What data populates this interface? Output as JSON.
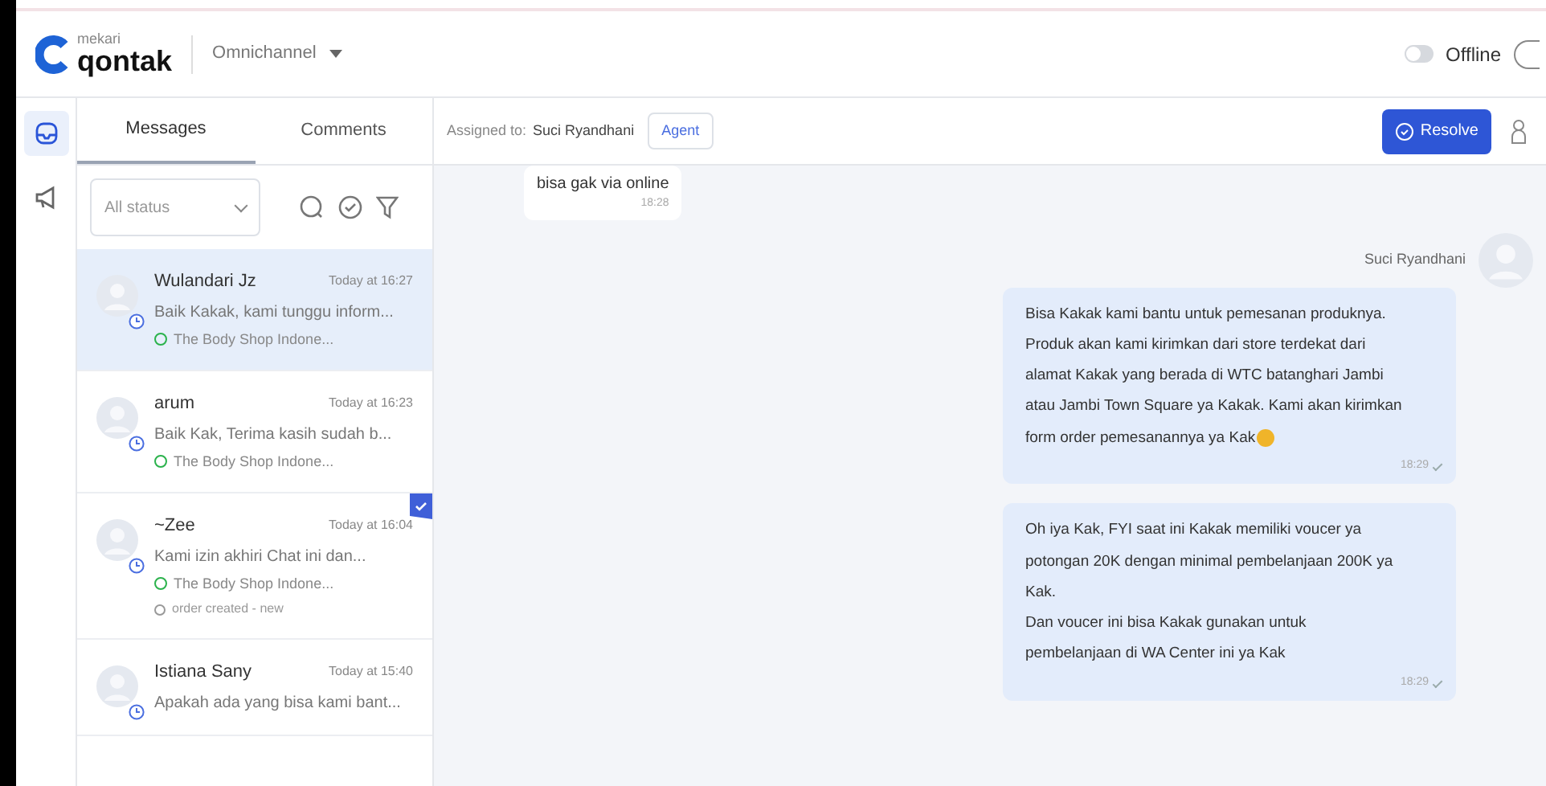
{
  "header": {
    "brand_small": "mekari",
    "brand": "qontak",
    "workspace": "Omnichannel",
    "status_toggle": {
      "on": false,
      "label": "Offline"
    }
  },
  "rail": [
    {
      "kind": "inbox",
      "selected": true
    },
    {
      "kind": "broadcast",
      "selected": false
    }
  ],
  "tabs": [
    {
      "label": "Messages",
      "selected": true
    },
    {
      "label": "Comments",
      "selected": false
    }
  ],
  "filter": {
    "value": "All status"
  },
  "conversations": [
    {
      "name": "Wulandari Jz",
      "time": "Today at 16:27",
      "preview": "Baik Kakak, kami tunggu inform...",
      "channel": "The Body Shop Indone...",
      "selected": true,
      "flagged": false
    },
    {
      "name": "arum",
      "time": "Today at 16:23",
      "preview": "Baik Kak, Terima kasih sudah b...",
      "channel": "The Body Shop Indone...",
      "selected": false,
      "flagged": false
    },
    {
      "name": "~Zee",
      "time": "Today at 16:04",
      "preview": "Kami izin akhiri Chat ini dan...",
      "channel": "The Body Shop Indone...",
      "tag": "order created - new",
      "selected": false,
      "flagged": true
    },
    {
      "name": "Istiana Sany",
      "time": "Today at 15:40",
      "preview": "Apakah ada yang bisa kami bant...",
      "selected": false,
      "flagged": false
    }
  ],
  "chat_header": {
    "assigned_label": "Assigned to:",
    "assignee": "Suci Ryandhani",
    "role": "Agent",
    "resolve": "Resolve"
  },
  "messages": [
    {
      "kind": "incoming",
      "lines": [
        "bisa gak via online"
      ],
      "time": "18:28"
    },
    {
      "kind": "outgoing",
      "sender": "Suci Ryandhani",
      "lines": [
        "Bisa Kakak kami bantu untuk pemesanan produknya.",
        "Produk akan kami kirimkan dari store terdekat dari",
        "alamat Kakak yang berada di WTC batanghari Jambi",
        "atau Jambi Town Square ya Kakak. Kami akan kirimkan",
        "form order pemesanannya ya Kak"
      ],
      "emoji": true,
      "time": "18:29"
    },
    {
      "kind": "outgoing",
      "lines": [
        "Oh iya Kak, FYI saat ini Kakak memiliki voucer ya",
        "potongan 20K dengan minimal pembelanjaan 200K ya",
        "Kak.",
        "Dan voucer ini bisa Kakak gunakan untuk",
        "pembelanjaan di WA Center ini ya Kak"
      ],
      "emoji": false,
      "time": "18:29"
    }
  ]
}
